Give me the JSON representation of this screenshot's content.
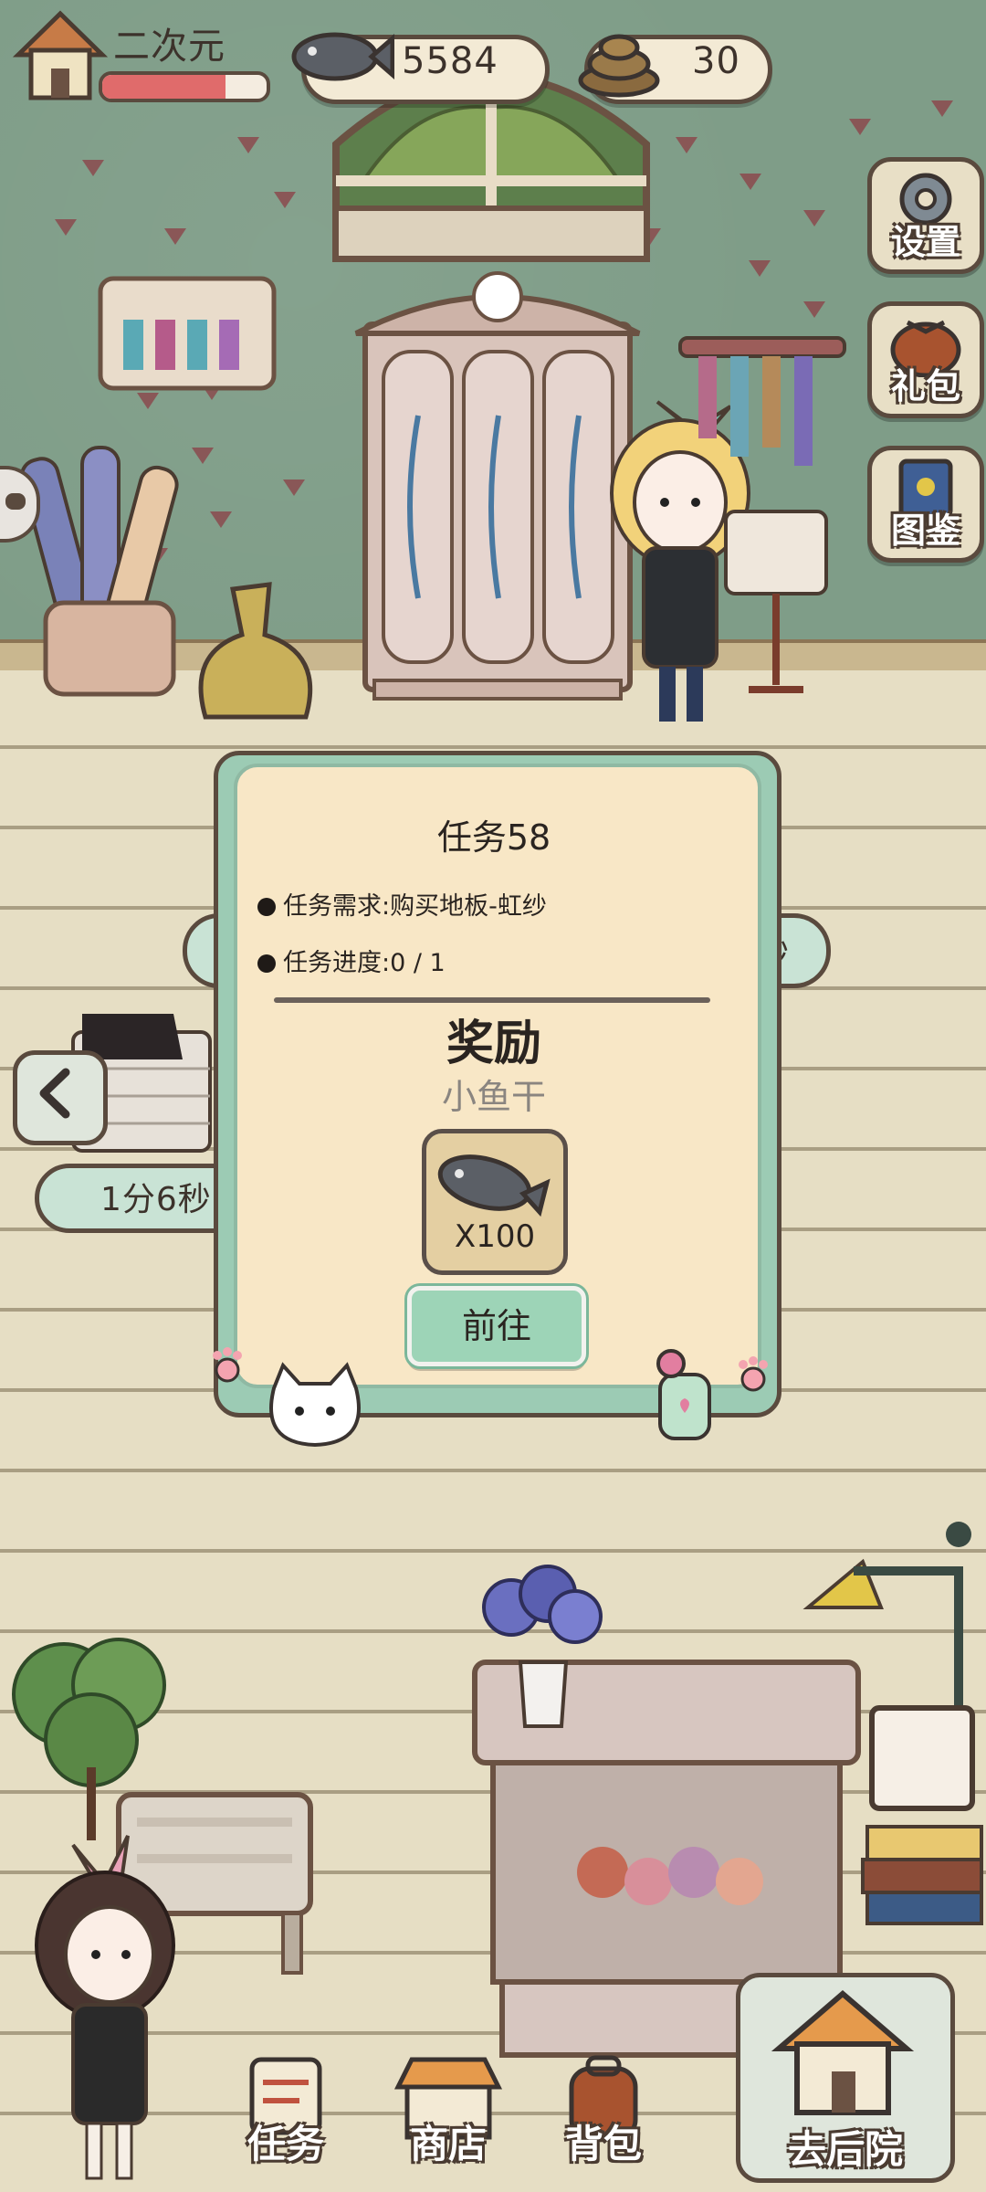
{
  "hud": {
    "player_name": "二次元",
    "health_fraction": 0.75,
    "fish_count": "5584",
    "poop_count": "30"
  },
  "side_menu": {
    "settings_label": "设置",
    "gift_label": "礼包",
    "catalog_label": "图鉴"
  },
  "left_panel": {
    "timer_text": "1分6秒",
    "behind_pill_text": "秒"
  },
  "task_modal": {
    "title": "任务58",
    "requirement": "任务需求:购买地板-虹纱",
    "progress": "任务进度:0 / 1",
    "reward_heading": "奖励",
    "reward_name": "小鱼干",
    "reward_quantity": "X100",
    "goto_button": "前往"
  },
  "bottom_nav": {
    "tasks": "任务",
    "shop": "商店",
    "bag": "背包",
    "backyard": "去后院"
  },
  "colors": {
    "wall": "#7f9d88",
    "floor": "#e6dec4",
    "modal_bg": "#f8e7c6",
    "modal_frame": "#9ccbb4",
    "goto_button": "#9dd4b7",
    "outline": "#5a4a3e"
  }
}
